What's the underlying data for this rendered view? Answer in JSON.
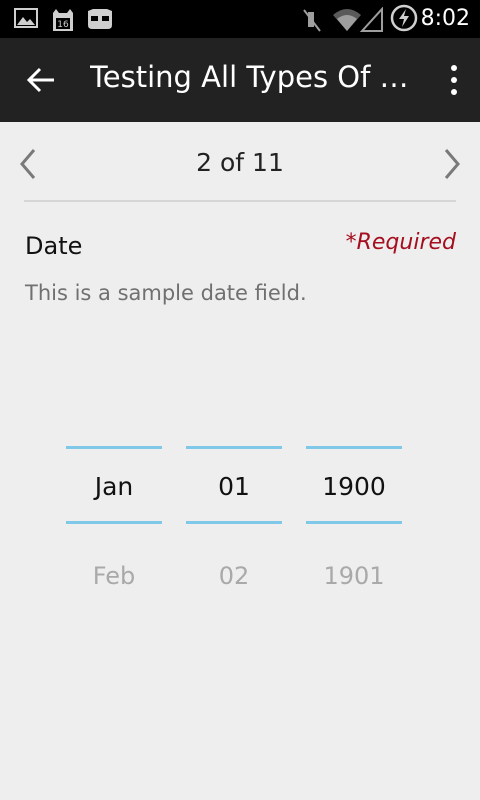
{
  "status_bar": {
    "time": "8:02",
    "left_icons": [
      "image-icon",
      "calendar-16-icon",
      "cyanogen-mascot-icon"
    ],
    "calendar_day": "16",
    "right_icons": [
      "mute-icon",
      "wifi-icon",
      "cell-signal-icon",
      "battery-charging-icon"
    ]
  },
  "action_bar": {
    "title": "Testing All Types Of F...",
    "background": "#222222"
  },
  "pager": {
    "indicator": "2 of 11"
  },
  "field": {
    "label": "Date",
    "required_text": "*Required",
    "required_color": "#a50e1e",
    "description": "This is a sample date field."
  },
  "date_picker": {
    "accent_color": "#7fc8e8",
    "month": {
      "current": "Jan",
      "next": "Feb"
    },
    "day": {
      "current": "01",
      "next": "02"
    },
    "year": {
      "current": "1900",
      "next": "1901"
    }
  }
}
